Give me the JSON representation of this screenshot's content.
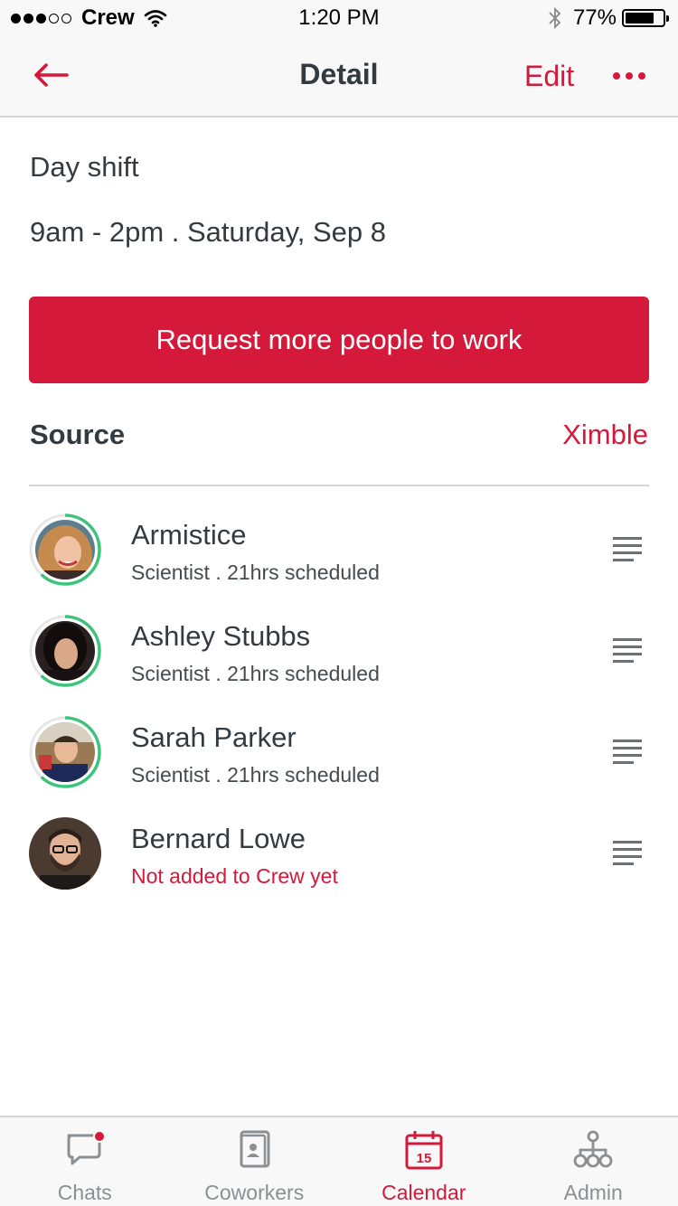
{
  "status_bar": {
    "carrier": "Crew",
    "time": "1:20 PM",
    "battery": "77%",
    "battery_level": 0.77
  },
  "nav": {
    "title": "Detail",
    "edit_label": "Edit"
  },
  "shift": {
    "name": "Day shift",
    "time": "9am - 2pm . Saturday, Sep 8"
  },
  "request_button": "Request more people to work",
  "source": {
    "label": "Source",
    "value": "Ximble"
  },
  "people": [
    {
      "name": "Armistice",
      "subtitle": "Scientist . 21hrs scheduled",
      "progress": 0.62,
      "subtitle_color": "#444b50"
    },
    {
      "name": "Ashley Stubbs",
      "subtitle": "Scientist . 21hrs scheduled",
      "progress": 0.62,
      "subtitle_color": "#444b50"
    },
    {
      "name": "Sarah Parker",
      "subtitle": "Scientist . 21hrs scheduled",
      "progress": 0.62,
      "subtitle_color": "#444b50"
    },
    {
      "name": "Bernard Lowe",
      "subtitle": "Not added to Crew yet",
      "progress": 0,
      "subtitle_color": "#d4193a"
    }
  ],
  "tabs": [
    {
      "label": "Chats",
      "icon": "chat-bubble-icon",
      "active": false,
      "badge": true
    },
    {
      "label": "Coworkers",
      "icon": "contact-card-icon",
      "active": false
    },
    {
      "label": "Calendar",
      "icon": "calendar-icon",
      "active": true,
      "calendar_day": "15"
    },
    {
      "label": "Admin",
      "icon": "org-chart-icon",
      "active": false
    }
  ],
  "colors": {
    "accent": "#d4193a",
    "progress_ring": "#3cc47c",
    "text": "#333a40",
    "muted": "#8a8f94"
  }
}
